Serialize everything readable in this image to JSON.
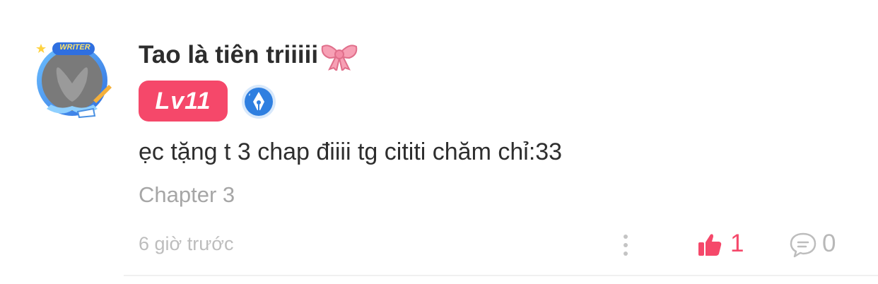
{
  "comment": {
    "user_name": "Tao là tiên triiiii",
    "avatar_frame_label": "WRITER",
    "level": "Lv11",
    "text": "ẹc tặng t 3 chap điiii tg cititi chăm chỉ:33",
    "chapter": "Chapter 3",
    "time": "6 giờ trước",
    "likes": "1",
    "replies": "0"
  },
  "colors": {
    "accent": "#f5486a",
    "muted": "#a6a6a6",
    "writer_badge": "#2f7fe0"
  },
  "icons": [
    "bow-emoji-icon",
    "writer-badge-icon",
    "more-icon",
    "like-icon",
    "reply-icon"
  ]
}
